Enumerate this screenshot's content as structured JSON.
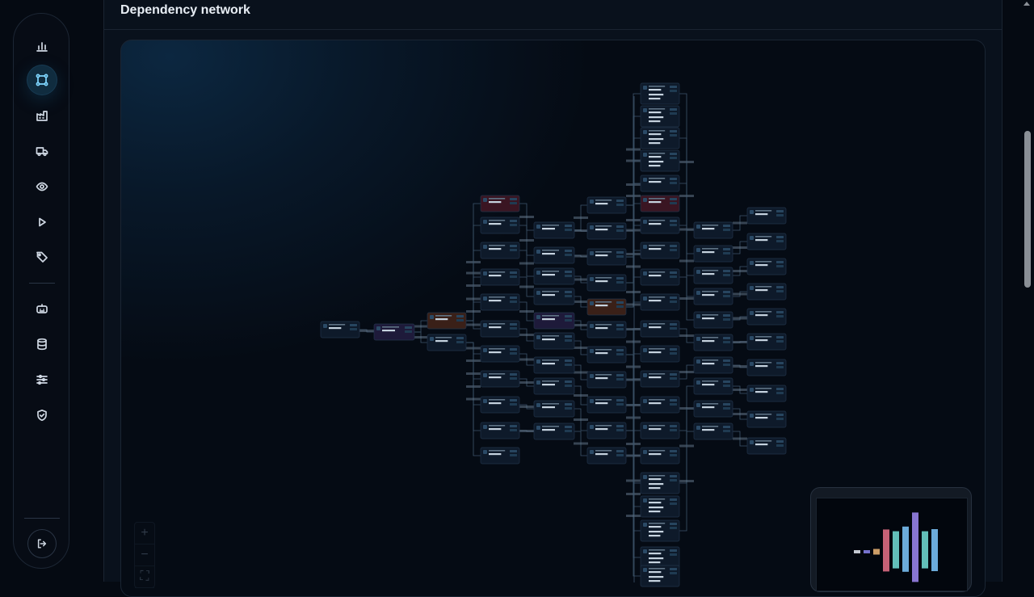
{
  "page": {
    "title": "Dependency network"
  },
  "sidebar": {
    "items": [
      {
        "name": "analytics",
        "icon": "bar-chart-icon"
      },
      {
        "name": "network",
        "icon": "network-icon",
        "active": true
      },
      {
        "name": "factory",
        "icon": "factory-icon"
      },
      {
        "name": "logistics",
        "icon": "truck-icon"
      },
      {
        "name": "monitoring",
        "icon": "eye-icon"
      },
      {
        "name": "run",
        "icon": "play-icon"
      },
      {
        "name": "tags",
        "icon": "tag-icon"
      },
      {
        "name": "assistant",
        "icon": "bot-icon"
      },
      {
        "name": "database",
        "icon": "database-icon"
      },
      {
        "name": "settings",
        "icon": "sliders-icon"
      },
      {
        "name": "security",
        "icon": "shield-check-icon"
      }
    ],
    "logout_icon": "logout-icon"
  },
  "canvas_controls": {
    "zoom_in": "+",
    "zoom_out": "−",
    "fit": "⛶"
  },
  "colors": {
    "accent": "#7fd6ff",
    "node_bg": "#0e1a2a",
    "node_border": "#22344a",
    "edge": "#3e566c"
  }
}
